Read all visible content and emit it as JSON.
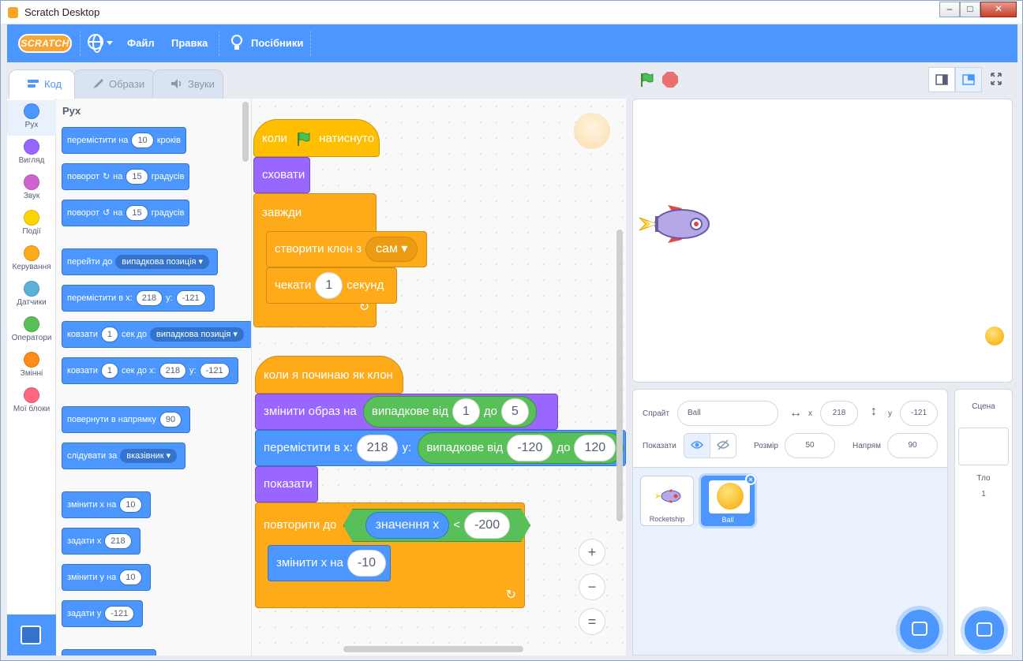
{
  "window": {
    "title": "Scratch Desktop",
    "minimize": "–",
    "maximize": "□",
    "close": "✕"
  },
  "menubar": {
    "logo": "SCRATCH",
    "file": "Файл",
    "edit": "Правка",
    "tutorials": "Посібники"
  },
  "tabs": [
    {
      "label": "Код",
      "active": true
    },
    {
      "label": "Образи"
    },
    {
      "label": "Звуки"
    }
  ],
  "categories": [
    {
      "label": "Рух",
      "color": "#4c97ff"
    },
    {
      "label": "Вигляд",
      "color": "#9966ff"
    },
    {
      "label": "Звук",
      "color": "#cf63cf"
    },
    {
      "label": "Події",
      "color": "#ffd500"
    },
    {
      "label": "Керування",
      "color": "#ffab19"
    },
    {
      "label": "Датчики",
      "color": "#5cb1d6"
    },
    {
      "label": "Оператори",
      "color": "#59c059"
    },
    {
      "label": "Змінні",
      "color": "#ff8c1a"
    },
    {
      "label": "Мої блоки",
      "color": "#ff6680"
    }
  ],
  "palette": {
    "title": "Рух",
    "move": {
      "a": "перемістити на",
      "v": "10",
      "b": "кроків"
    },
    "turn_right": {
      "a": "поворот",
      "icon": "↻",
      "b": "на",
      "v": "15",
      "c": "градусів"
    },
    "turn_left": {
      "a": "поворот",
      "icon": "↺",
      "b": "на",
      "v": "15",
      "c": "градусів"
    },
    "goto": {
      "a": "перейти до",
      "dd": "випадкова позиція ▾"
    },
    "gotoxy": {
      "a": "перемістити в x:",
      "x": "218",
      "b": "y:",
      "y": "-121"
    },
    "glide": {
      "a": "ковзати",
      "v": "1",
      "b": "сек до",
      "dd": "випадкова позиція ▾"
    },
    "glidexy": {
      "a": "ковзати",
      "v": "1",
      "b": "сек до x:",
      "x": "218",
      "c": "y:",
      "y": "-121"
    },
    "point": {
      "a": "повернути в напрямку",
      "v": "90"
    },
    "follow": {
      "a": "слідувати за",
      "dd": "вказівник ▾"
    },
    "changex": {
      "a": "змінити х на",
      "v": "10"
    },
    "setx": {
      "a": "задати х",
      "v": "218"
    },
    "changey": {
      "a": "змінити у на",
      "v": "10"
    },
    "sety": {
      "a": "задати у",
      "v": "-121"
    }
  },
  "script1": {
    "when_flag": {
      "a": "коли",
      "b": "натиснуто"
    },
    "hide": "сховати",
    "forever": "завжди",
    "create_clone": {
      "a": "створити клон з",
      "dd": "сам ▾"
    },
    "wait": {
      "a": "чекати",
      "v": "1",
      "b": "секунд"
    }
  },
  "script2": {
    "hat": "коли я починаю як клон",
    "switch": {
      "a": "змінити образ на",
      "rand": "випадкове від",
      "from": "1",
      "to_word": "до",
      "to": "5"
    },
    "goto": {
      "a": "перемістити в x:",
      "x": "218",
      "b": "y:",
      "rand": "випадкове від",
      "from": "-120",
      "to_word": "до",
      "to": "120"
    },
    "show": "показати",
    "repeat": {
      "a": "повторити до",
      "val": "значення х",
      "op": "<",
      "v": "-200"
    },
    "changex": {
      "a": "змінити х на",
      "v": "-10"
    }
  },
  "zoom": {
    "in": "+",
    "out": "−",
    "reset": "="
  },
  "sprite_info": {
    "sprite_label": "Спрайт",
    "sprite_name": "Ball",
    "x_label": "x",
    "x": "218",
    "y_label": "y",
    "y": "-121",
    "show_label": "Показати",
    "size_label": "Розмір",
    "size": "50",
    "dir_label": "Напрям",
    "dir": "90"
  },
  "sprites": [
    {
      "name": "Rocketship"
    },
    {
      "name": "Ball",
      "selected": true
    }
  ],
  "scene": {
    "title": "Сцена",
    "backdrops_label": "Тло",
    "backdrops": "1"
  }
}
